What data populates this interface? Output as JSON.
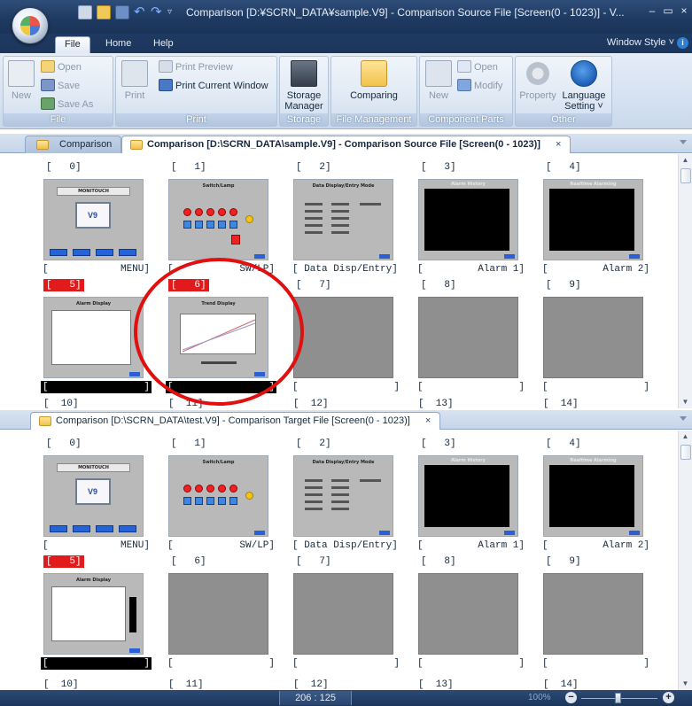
{
  "window": {
    "title": "Comparison [D:¥SCRN_DATA¥sample.V9] - Comparison Source File [Screen(0 - 1023)] - V...",
    "qat_dropdown": "▿"
  },
  "ribbon_tabs": [
    {
      "label": "File"
    },
    {
      "label": "Home"
    },
    {
      "label": "Help"
    }
  ],
  "window_style": "Window Style ˅",
  "groups": {
    "file": {
      "label": "File",
      "new": "New",
      "open": "Open",
      "save": "Save",
      "save_as": "Save As"
    },
    "print": {
      "label": "Print",
      "print": "Print",
      "print_preview": "Print Preview",
      "print_current": "Print Current Window"
    },
    "storage": {
      "label": "Storage",
      "storage_manager_1": "Storage",
      "storage_manager_2": "Manager"
    },
    "file_management": {
      "label": "File Management",
      "comparing": "Comparing"
    },
    "component_parts": {
      "label": "Component Parts",
      "new": "New",
      "open": "Open",
      "modify": "Modify"
    },
    "other": {
      "label": "Other",
      "property": "Property",
      "language_1": "Language",
      "language_2": "Setting ˅"
    }
  },
  "source_pane": {
    "tabs": [
      {
        "label": "Comparison"
      },
      {
        "label": "Comparison [D:\\SCRN_DATA\\sample.V9] - Comparison Source File [Screen(0 - 1023)]"
      }
    ],
    "close": "×",
    "screens": [
      {
        "no": "[   0]",
        "name_left": "[",
        "name_right": "MENU]"
      },
      {
        "no": "[   1]",
        "name_left": "[",
        "name_right": "SW/LP]"
      },
      {
        "no": "[   2]",
        "name_left": "[ Data Disp/Entry]",
        "name_right": ""
      },
      {
        "no": "[   3]",
        "name_left": "[",
        "name_right": "Alarm 1]"
      },
      {
        "no": "[   4]",
        "name_left": "[",
        "name_right": "Alarm 2]"
      },
      {
        "no": "[   5]",
        "name_left": "[",
        "name_right": "]"
      },
      {
        "no": "[   6]",
        "name_left": "[",
        "name_right": "]"
      },
      {
        "no": "[   7]",
        "name_left": "[",
        "name_right": "]"
      },
      {
        "no": "[   8]",
        "name_left": "[",
        "name_right": "]"
      },
      {
        "no": "[   9]",
        "name_left": "[",
        "name_right": "]"
      }
    ],
    "next_row": [
      "[  10]",
      "[  11]",
      "[  12]",
      "[  13]",
      "[  14]"
    ]
  },
  "target_pane": {
    "tab_label": "Comparison [D:\\SCRN_DATA\\test.V9] - Comparison Target File [Screen(0 - 1023)]",
    "close": "×",
    "screens": [
      {
        "no": "[   0]",
        "name_left": "[",
        "name_right": "MENU]"
      },
      {
        "no": "[   1]",
        "name_left": "[",
        "name_right": "SW/LP]"
      },
      {
        "no": "[   2]",
        "name_left": "[ Data Disp/Entry]",
        "name_right": ""
      },
      {
        "no": "[   3]",
        "name_left": "[",
        "name_right": "Alarm 1]"
      },
      {
        "no": "[   4]",
        "name_left": "[",
        "name_right": "Alarm 2]"
      },
      {
        "no": "[   5]",
        "name_left": "[",
        "name_right": "]"
      },
      {
        "no": "[   6]",
        "name_left": "[",
        "name_right": "]"
      },
      {
        "no": "[   7]",
        "name_left": "[",
        "name_right": "]"
      },
      {
        "no": "[   8]",
        "name_left": "[",
        "name_right": "]"
      },
      {
        "no": "[   9]",
        "name_left": "[",
        "name_right": "]"
      }
    ],
    "next_row": [
      "[  10]",
      "[  11]",
      "[  12]",
      "[  13]",
      "[  14]"
    ]
  },
  "thumb_text": {
    "menu_logo": "MONITOUCH",
    "switch_lamp": "Switch/Lamp",
    "data_display": "Data Display/Entry Mode",
    "alarm_history": "Alarm History",
    "realtime_alarming": "Realtime Alarming",
    "alarm_display": "Alarm Display",
    "trend_display": "Trend Display"
  },
  "statusbar": {
    "coord": "206 : 125",
    "zoom": "100%",
    "zoom_minus": "−",
    "zoom_plus": "+"
  },
  "colors": {
    "title_bar": "#1f3a62",
    "difference_highlight": "#e11b1b",
    "annotation_circle": "#e01010"
  }
}
